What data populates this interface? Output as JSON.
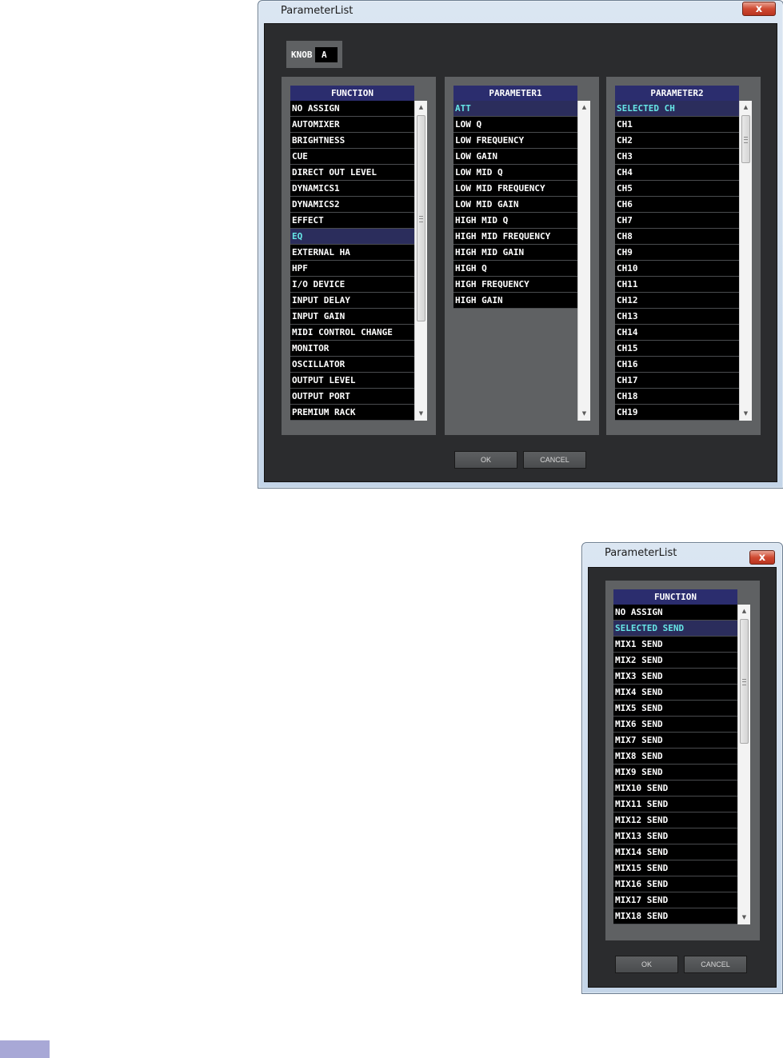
{
  "dialog1": {
    "title": "ParameterList",
    "close_label": "x",
    "knob": {
      "label": "KNOB",
      "value": "A"
    },
    "function": {
      "header": "FUNCTION",
      "items": [
        {
          "label": "NO ASSIGN",
          "selected": false
        },
        {
          "label": "AUTOMIXER",
          "selected": false
        },
        {
          "label": "BRIGHTNESS",
          "selected": false
        },
        {
          "label": "CUE",
          "selected": false
        },
        {
          "label": "DIRECT OUT LEVEL",
          "selected": false
        },
        {
          "label": "DYNAMICS1",
          "selected": false
        },
        {
          "label": "DYNAMICS2",
          "selected": false
        },
        {
          "label": "EFFECT",
          "selected": false
        },
        {
          "label": "EQ",
          "selected": true
        },
        {
          "label": "EXTERNAL HA",
          "selected": false
        },
        {
          "label": "HPF",
          "selected": false
        },
        {
          "label": "I/O DEVICE",
          "selected": false
        },
        {
          "label": "INPUT DELAY",
          "selected": false
        },
        {
          "label": "INPUT GAIN",
          "selected": false
        },
        {
          "label": "MIDI CONTROL CHANGE",
          "selected": false
        },
        {
          "label": "MONITOR",
          "selected": false
        },
        {
          "label": "OSCILLATOR",
          "selected": false
        },
        {
          "label": "OUTPUT LEVEL",
          "selected": false
        },
        {
          "label": "OUTPUT PORT",
          "selected": false
        },
        {
          "label": "PREMIUM RACK",
          "selected": false
        }
      ]
    },
    "parameter1": {
      "header": "PARAMETER1",
      "items": [
        {
          "label": "ATT",
          "selected": true
        },
        {
          "label": "LOW Q",
          "selected": false
        },
        {
          "label": "LOW FREQUENCY",
          "selected": false
        },
        {
          "label": "LOW GAIN",
          "selected": false
        },
        {
          "label": "LOW MID Q",
          "selected": false
        },
        {
          "label": "LOW MID FREQUENCY",
          "selected": false
        },
        {
          "label": "LOW MID GAIN",
          "selected": false
        },
        {
          "label": "HIGH MID Q",
          "selected": false
        },
        {
          "label": "HIGH MID FREQUENCY",
          "selected": false
        },
        {
          "label": "HIGH MID GAIN",
          "selected": false
        },
        {
          "label": "HIGH Q",
          "selected": false
        },
        {
          "label": "HIGH FREQUENCY",
          "selected": false
        },
        {
          "label": "HIGH GAIN",
          "selected": false
        }
      ]
    },
    "parameter2": {
      "header": "PARAMETER2",
      "items": [
        {
          "label": "SELECTED CH",
          "selected": true
        },
        {
          "label": "CH1",
          "selected": false
        },
        {
          "label": "CH2",
          "selected": false
        },
        {
          "label": "CH3",
          "selected": false
        },
        {
          "label": "CH4",
          "selected": false
        },
        {
          "label": "CH5",
          "selected": false
        },
        {
          "label": "CH6",
          "selected": false
        },
        {
          "label": "CH7",
          "selected": false
        },
        {
          "label": "CH8",
          "selected": false
        },
        {
          "label": "CH9",
          "selected": false
        },
        {
          "label": "CH10",
          "selected": false
        },
        {
          "label": "CH11",
          "selected": false
        },
        {
          "label": "CH12",
          "selected": false
        },
        {
          "label": "CH13",
          "selected": false
        },
        {
          "label": "CH14",
          "selected": false
        },
        {
          "label": "CH15",
          "selected": false
        },
        {
          "label": "CH16",
          "selected": false
        },
        {
          "label": "CH17",
          "selected": false
        },
        {
          "label": "CH18",
          "selected": false
        },
        {
          "label": "CH19",
          "selected": false
        }
      ]
    },
    "ok_label": "OK",
    "cancel_label": "CANCEL"
  },
  "dialog2": {
    "title": "ParameterList",
    "close_label": "x",
    "function": {
      "header": "FUNCTION",
      "items": [
        {
          "label": "NO ASSIGN",
          "selected": false
        },
        {
          "label": "SELECTED SEND",
          "selected": true
        },
        {
          "label": "MIX1 SEND",
          "selected": false
        },
        {
          "label": "MIX2 SEND",
          "selected": false
        },
        {
          "label": "MIX3 SEND",
          "selected": false
        },
        {
          "label": "MIX4 SEND",
          "selected": false
        },
        {
          "label": "MIX5 SEND",
          "selected": false
        },
        {
          "label": "MIX6 SEND",
          "selected": false
        },
        {
          "label": "MIX7 SEND",
          "selected": false
        },
        {
          "label": "MIX8 SEND",
          "selected": false
        },
        {
          "label": "MIX9 SEND",
          "selected": false
        },
        {
          "label": "MIX10 SEND",
          "selected": false
        },
        {
          "label": "MIX11 SEND",
          "selected": false
        },
        {
          "label": "MIX12 SEND",
          "selected": false
        },
        {
          "label": "MIX13 SEND",
          "selected": false
        },
        {
          "label": "MIX14 SEND",
          "selected": false
        },
        {
          "label": "MIX15 SEND",
          "selected": false
        },
        {
          "label": "MIX16 SEND",
          "selected": false
        },
        {
          "label": "MIX17 SEND",
          "selected": false
        },
        {
          "label": "MIX18 SEND",
          "selected": false
        }
      ]
    },
    "ok_label": "OK",
    "cancel_label": "CANCEL"
  },
  "colors": {
    "selected_text": "#66e6e6",
    "header_bg": "#2b2d6e",
    "panel_bg": "#5f6163",
    "client_bg": "#2b2c2e"
  },
  "icons": {
    "scroll_up": "up-arrow-icon",
    "scroll_down": "down-arrow-icon",
    "close": "close-icon"
  }
}
